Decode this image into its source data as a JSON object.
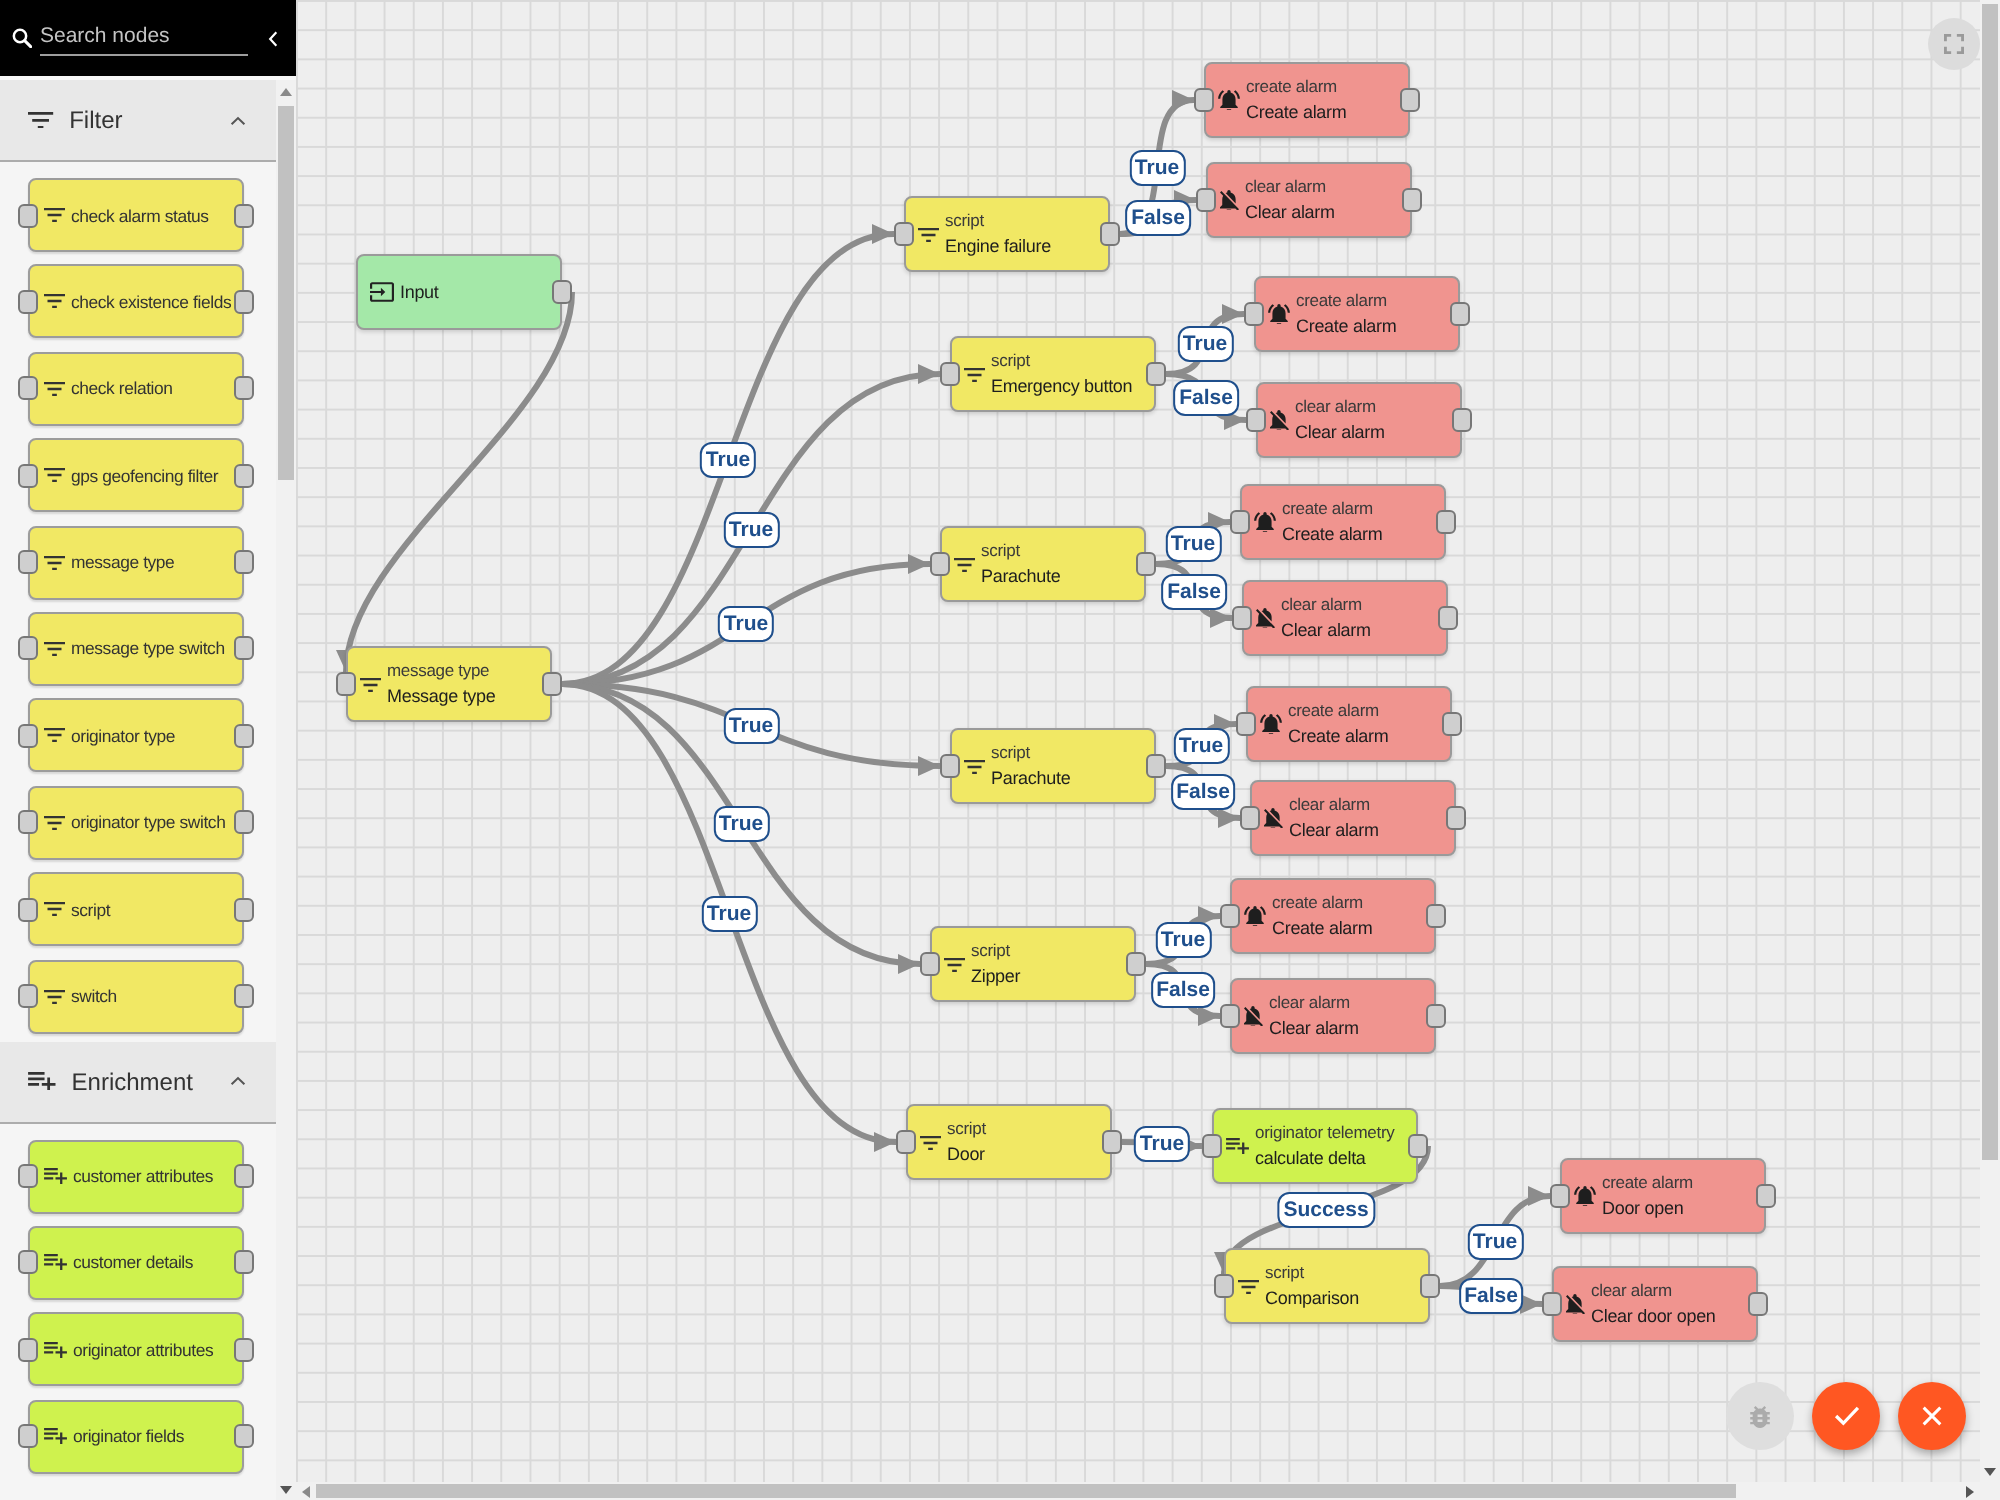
{
  "sidebar": {
    "search": {
      "placeholder": "Search nodes"
    },
    "sections": [
      {
        "title": "Filter",
        "kind": "filter",
        "expanded": true,
        "items": [
          "check alarm status",
          "check existence fields",
          "check relation",
          "gps geofencing filter",
          "message type",
          "message type switch",
          "originator type",
          "originator type switch",
          "script",
          "switch"
        ]
      },
      {
        "title": "Enrichment",
        "kind": "enrichment",
        "expanded": true,
        "items": [
          "customer attributes",
          "customer details",
          "originator attributes",
          "originator fields"
        ]
      }
    ]
  },
  "canvas": {
    "nodes": [
      {
        "kind": "input",
        "name": "Input",
        "children": [
          {
            "kind": "filter",
            "type": "message type",
            "name": "Message type",
            "children": [
              {
                "kind": "filter",
                "link": "True",
                "type": "script",
                "name": "Engine failure",
                "children": [
                  {
                    "kind": "alarm_create",
                    "link": "True",
                    "type": "create alarm",
                    "name": "Create alarm"
                  },
                  {
                    "kind": "alarm_clear",
                    "link": "False",
                    "type": "clear alarm",
                    "name": "Clear alarm"
                  }
                ]
              },
              {
                "kind": "filter",
                "link": "True",
                "type": "script",
                "name": "Emergency button",
                "children": [
                  {
                    "kind": "alarm_create",
                    "link": "True",
                    "type": "create alarm",
                    "name": "Create alarm"
                  },
                  {
                    "kind": "alarm_clear",
                    "link": "False",
                    "type": "clear alarm",
                    "name": "Clear alarm"
                  }
                ]
              },
              {
                "kind": "filter",
                "link": "True",
                "type": "script",
                "name": "Parachute",
                "children": [
                  {
                    "kind": "alarm_create",
                    "link": "True",
                    "type": "create alarm",
                    "name": "Create alarm"
                  },
                  {
                    "kind": "alarm_clear",
                    "link": "False",
                    "type": "clear alarm",
                    "name": "Clear alarm"
                  }
                ]
              },
              {
                "kind": "filter",
                "link": "True",
                "type": "script",
                "name": "Parachute",
                "children": [
                  {
                    "kind": "alarm_create",
                    "link": "True",
                    "type": "create alarm",
                    "name": "Create alarm"
                  },
                  {
                    "kind": "alarm_clear",
                    "link": "False",
                    "type": "clear alarm",
                    "name": "Clear alarm"
                  }
                ]
              },
              {
                "kind": "filter",
                "link": "True",
                "type": "script",
                "name": "Zipper",
                "children": [
                  {
                    "kind": "alarm_create",
                    "link": "True",
                    "type": "create alarm",
                    "name": "Create alarm"
                  },
                  {
                    "kind": "alarm_clear",
                    "link": "False",
                    "type": "clear alarm",
                    "name": "Clear alarm"
                  }
                ]
              },
              {
                "kind": "filter",
                "link": "True",
                "type": "script",
                "name": "Door",
                "children": [
                  {
                    "kind": "enrichment",
                    "link": "True",
                    "type": "originator telemetry",
                    "name": "calculate delta",
                    "children": [
                      {
                        "kind": "filter",
                        "link": "Success",
                        "type": "script",
                        "name": "Comparison",
                        "children": [
                          {
                            "kind": "alarm_create",
                            "link": "True",
                            "type": "create alarm",
                            "name": "Door open"
                          },
                          {
                            "kind": "alarm_clear",
                            "link": "False",
                            "type": "clear alarm",
                            "name": "Clear door open"
                          }
                        ]
                      }
                    ]
                  }
                ]
              }
            ]
          }
        ]
      }
    ]
  },
  "actions": [
    {
      "kind": "debug",
      "disabled": true
    },
    {
      "kind": "apply",
      "disabled": false
    },
    {
      "kind": "cancel",
      "disabled": false
    }
  ]
}
